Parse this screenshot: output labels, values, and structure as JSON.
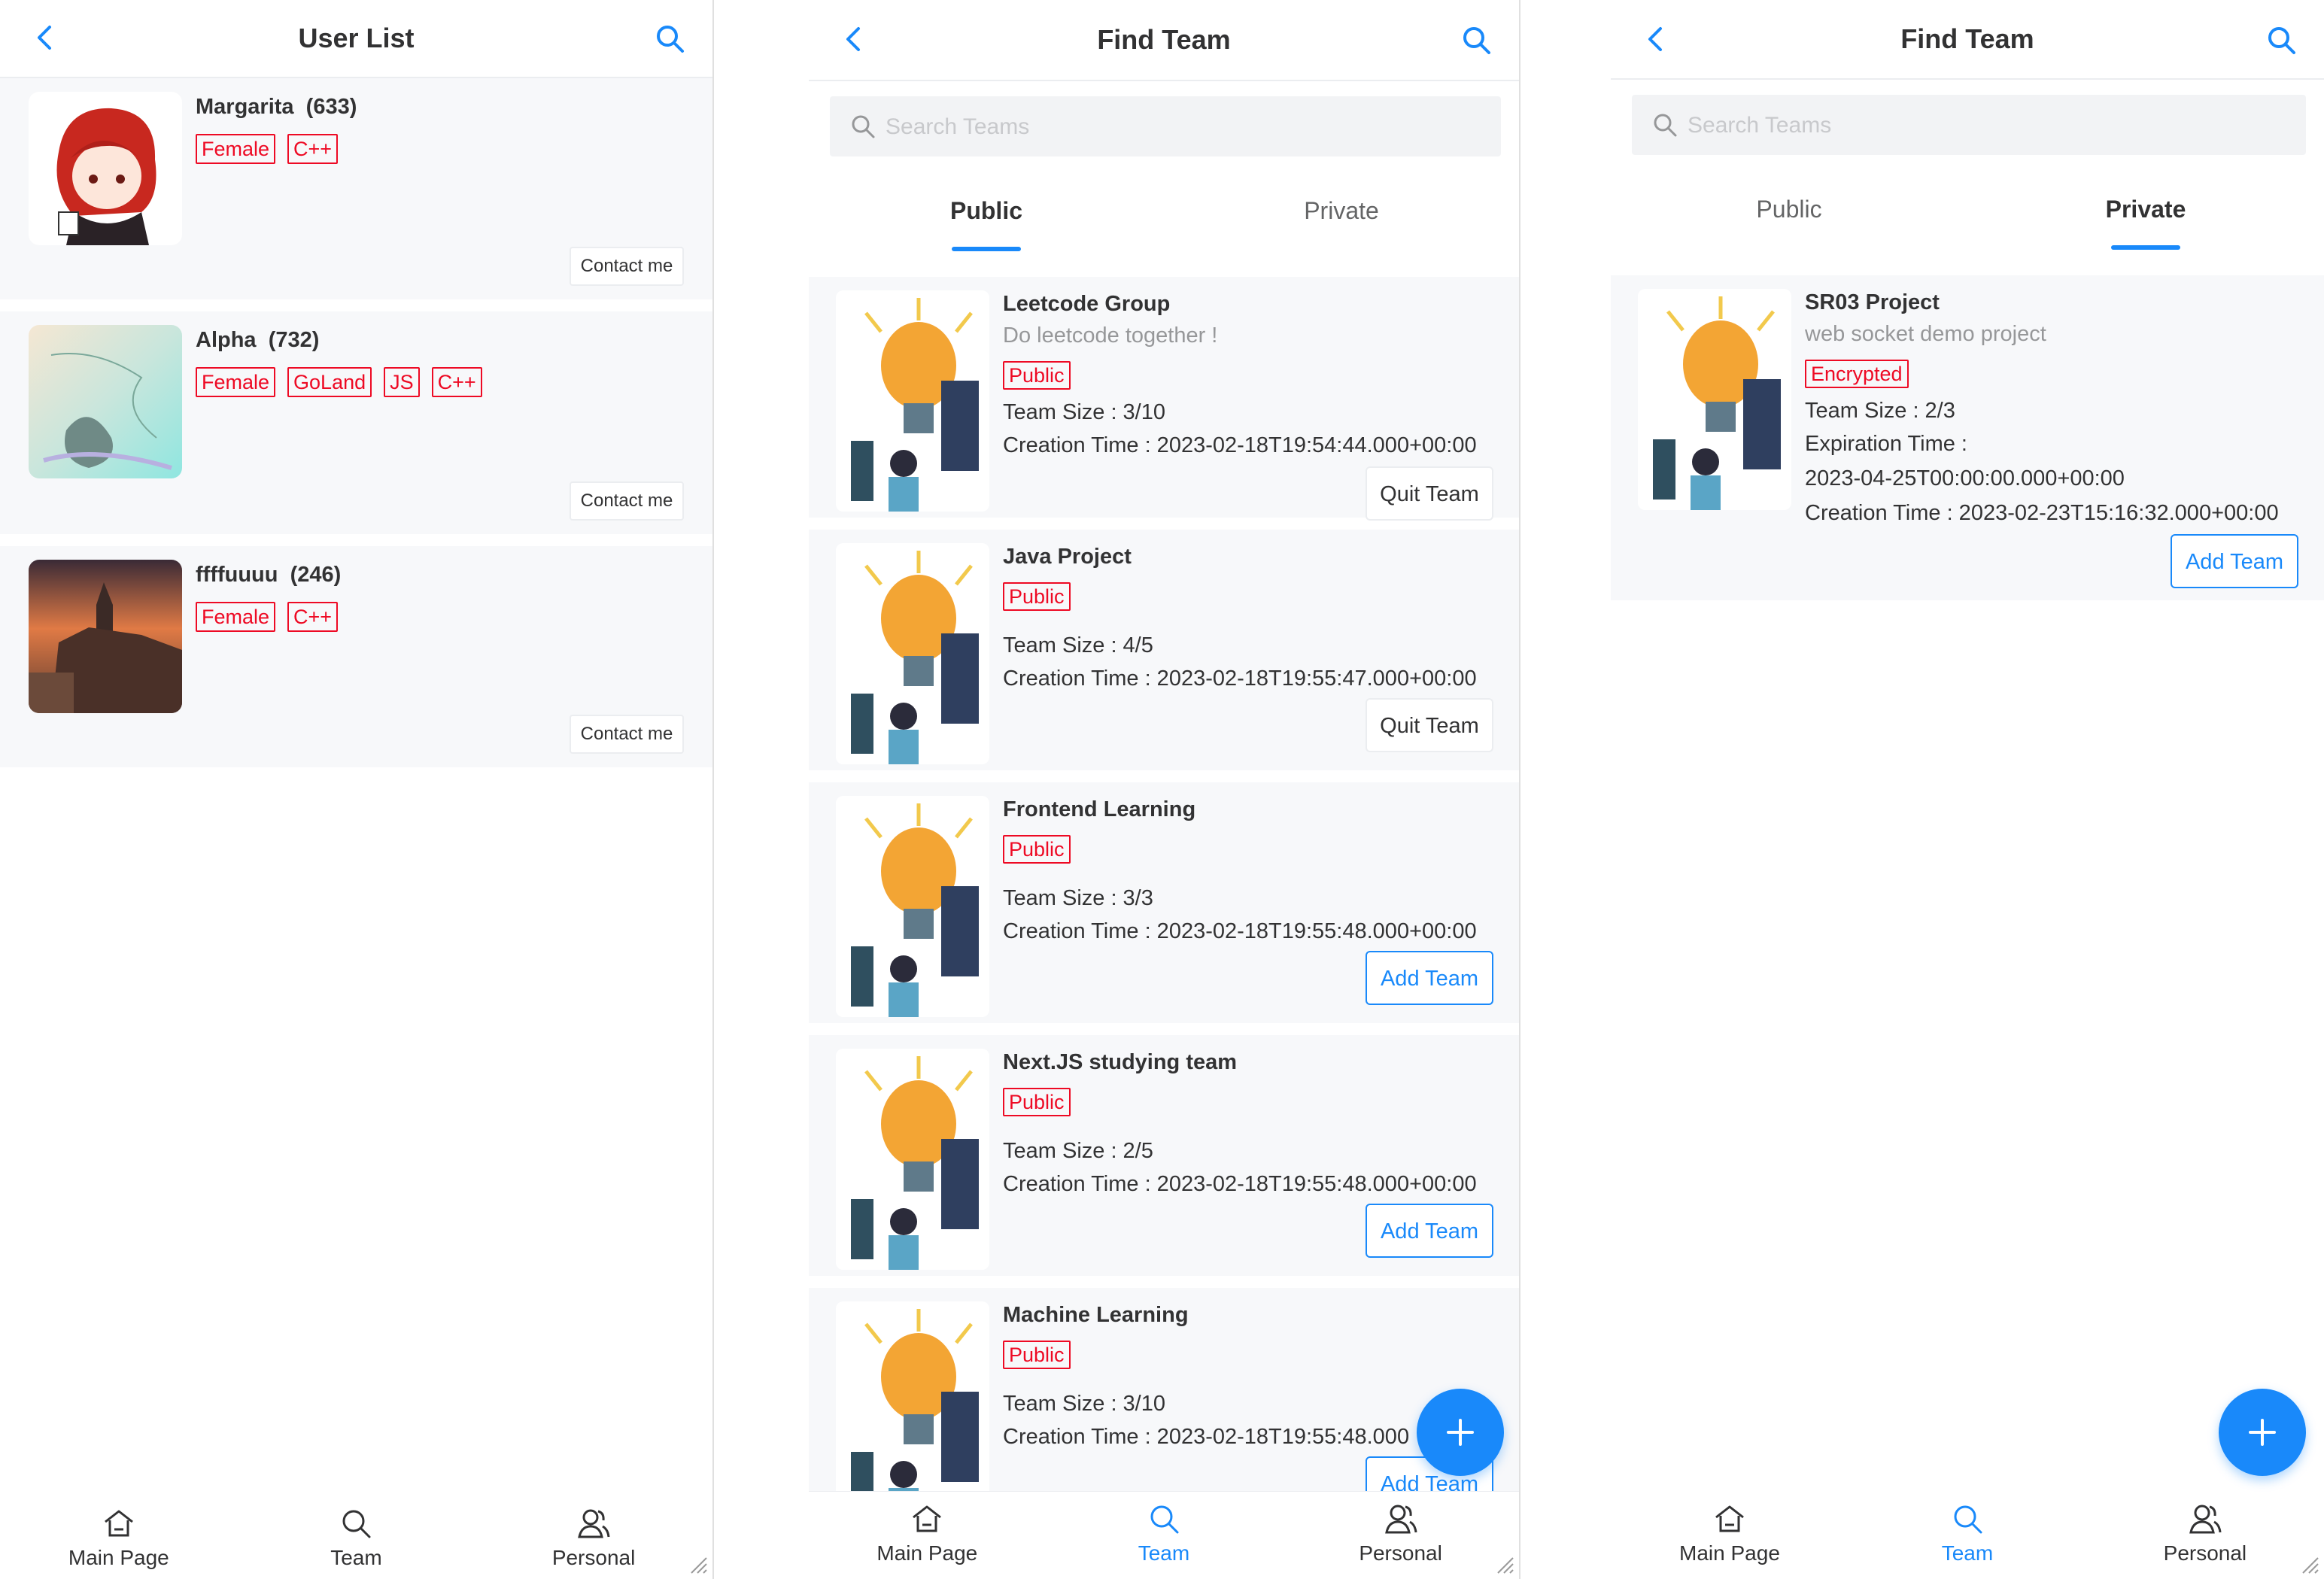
{
  "colors": {
    "accent": "#1989fa",
    "tag_red": "#ee0a24",
    "card_bg": "#f7f8fa"
  },
  "screen1": {
    "title": "User List",
    "users": [
      {
        "name": "Margarita",
        "count": "(633)",
        "tags": [
          "Female",
          "C++"
        ],
        "contact": "Contact me"
      },
      {
        "name": "Alpha",
        "count": "(732)",
        "tags": [
          "Female",
          "GoLand",
          "JS",
          "C++"
        ],
        "contact": "Contact me"
      },
      {
        "name": "ffffuuuu",
        "count": "(246)",
        "tags": [
          "Female",
          "C++"
        ],
        "contact": "Contact me"
      }
    ],
    "tabbar": [
      {
        "label": "Main Page",
        "icon": "home-icon"
      },
      {
        "label": "Team",
        "icon": "search-icon"
      },
      {
        "label": "Personal",
        "icon": "personal-icon"
      }
    ]
  },
  "screen2": {
    "title": "Find Team",
    "search_placeholder": "Search Teams",
    "tabs": [
      "Public",
      "Private"
    ],
    "active_tab": "Public",
    "teams": [
      {
        "name": "Leetcode Group",
        "desc": "Do leetcode together !",
        "tag": "Public",
        "size": "Team Size : 3/10",
        "created": "Creation Time : 2023-02-18T19:54:44.000+00:00",
        "button": "Quit Team"
      },
      {
        "name": "Java Project",
        "desc": "",
        "tag": "Public",
        "size": "Team Size : 4/5",
        "created": "Creation Time : 2023-02-18T19:55:47.000+00:00",
        "button": "Quit Team"
      },
      {
        "name": "Frontend Learning",
        "desc": "",
        "tag": "Public",
        "size": "Team Size : 3/3",
        "created": "Creation Time : 2023-02-18T19:55:48.000+00:00",
        "button": "Add Team"
      },
      {
        "name": "Next.JS studying team",
        "desc": "",
        "tag": "Public",
        "size": "Team Size : 2/5",
        "created": "Creation Time : 2023-02-18T19:55:48.000+00:00",
        "button": "Add Team"
      },
      {
        "name": "Machine Learning",
        "desc": "",
        "tag": "Public",
        "size": "Team Size : 3/10",
        "created": "Creation Time : 2023-02-18T19:55:48.000",
        "button": "Add Team"
      }
    ],
    "tabbar": [
      {
        "label": "Main Page",
        "icon": "home-icon"
      },
      {
        "label": "Team",
        "icon": "search-icon"
      },
      {
        "label": "Personal",
        "icon": "personal-icon"
      }
    ]
  },
  "screen3": {
    "title": "Find Team",
    "search_placeholder": "Search Teams",
    "tabs": [
      "Public",
      "Private"
    ],
    "active_tab": "Private",
    "team": {
      "name": "SR03 Project",
      "desc": "web socket demo project",
      "tag": "Encrypted",
      "size": "Team Size : 2/3",
      "expiration_label": "Expiration Time :",
      "expiration_value": "2023-04-25T00:00:00.000+00:00",
      "created": "Creation Time : 2023-02-23T15:16:32.000+00:00",
      "button": "Add Team"
    },
    "tabbar": [
      {
        "label": "Main Page",
        "icon": "home-icon"
      },
      {
        "label": "Team",
        "icon": "search-icon"
      },
      {
        "label": "Personal",
        "icon": "personal-icon"
      }
    ]
  }
}
